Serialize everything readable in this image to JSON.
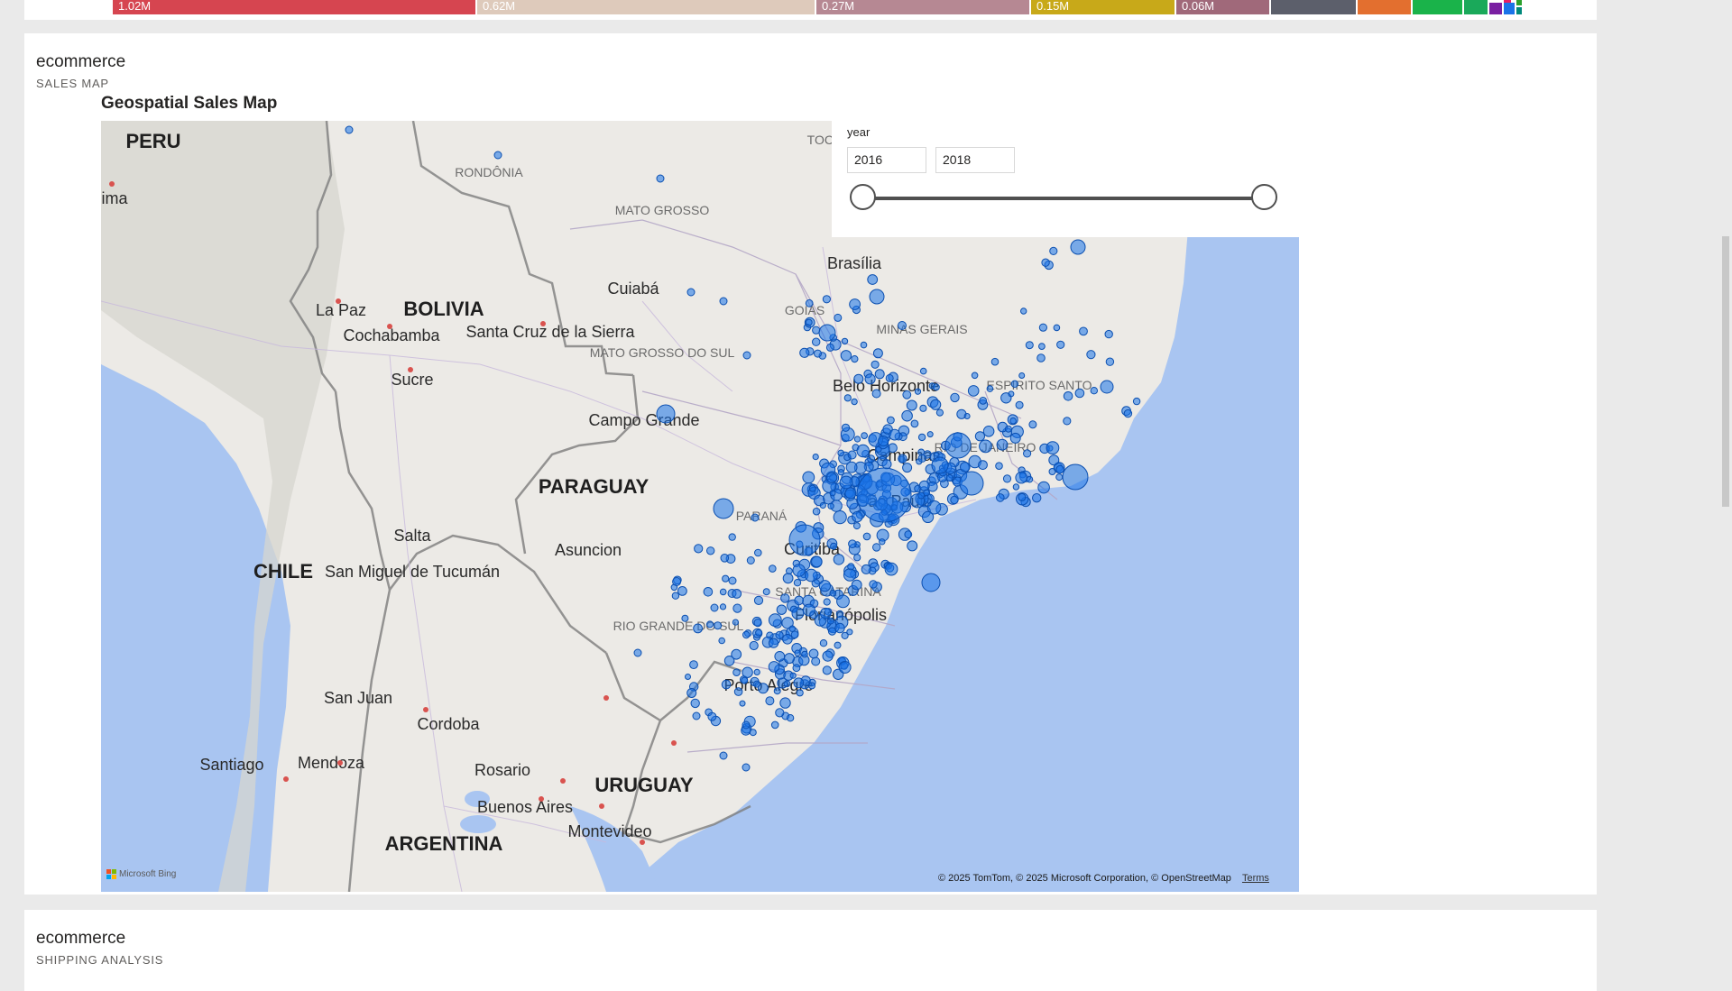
{
  "top_treemap": {
    "segments": [
      {
        "label": "1.02M",
        "color": "#d64550"
      },
      {
        "label": "0.62M",
        "color": "#decabb"
      },
      {
        "label": "0.27M",
        "color": "#b68893"
      },
      {
        "label": "0.15M",
        "color": "#c8a919"
      },
      {
        "label": "0.06M",
        "color": "#a0697a"
      },
      {
        "label": "",
        "color": "#5c5f6b"
      },
      {
        "label": "",
        "color": "#e36f2f"
      },
      {
        "label": "",
        "color": "#1ab34a"
      },
      {
        "label": "",
        "color": "#1aa95a"
      }
    ]
  },
  "map_card": {
    "title": "ecommerce",
    "subtitle": "SALES MAP",
    "visual_title": "Geospatial Sales Map",
    "bubble_color": "#1a73e8",
    "slicer": {
      "title": "year",
      "from": "2016",
      "to": "2018",
      "range": [
        0,
        1
      ]
    },
    "map_labels": {
      "countries": [
        "PERU",
        "BOLIVIA",
        "PARAGUAY",
        "CHILE",
        "URUGUAY",
        "ARGENTINA"
      ],
      "states": [
        "RONDÔNIA",
        "MATO GROSSO",
        "TOCA",
        "GOIÁS",
        "MINAS GERAIS",
        "MATO GROSSO DO SUL",
        "ESPIRITO SANTO",
        "PARANÁ",
        "SANTA CATARINA",
        "RIO GRANDE DO SUL",
        "RIO DE JANEIRO"
      ],
      "cities": [
        "Lima",
        "La Paz",
        "Cochabamba",
        "Sucre",
        "Santa Cruz de la Sierra",
        "Cuiabá",
        "Brasília",
        "Campo Grande",
        "Belo Horizonte",
        "Campinas",
        "São Paulo",
        "Curitiba",
        "Florianópolis",
        "Porto Alegre",
        "Asuncion",
        "Salta",
        "San Miguel de Tucumán",
        "San Juan",
        "Cordoba",
        "Santiago",
        "Mendoza",
        "Rosario",
        "Buenos Aires",
        "Montevideo"
      ]
    },
    "bing_logo": "Microsoft Bing",
    "attribution": "© 2025 TomTom, © 2025 Microsoft Corporation, © OpenStreetMap",
    "terms": "Terms"
  },
  "shipping_card": {
    "title": "ecommerce",
    "subtitle": "SHIPPING ANALYSIS"
  }
}
